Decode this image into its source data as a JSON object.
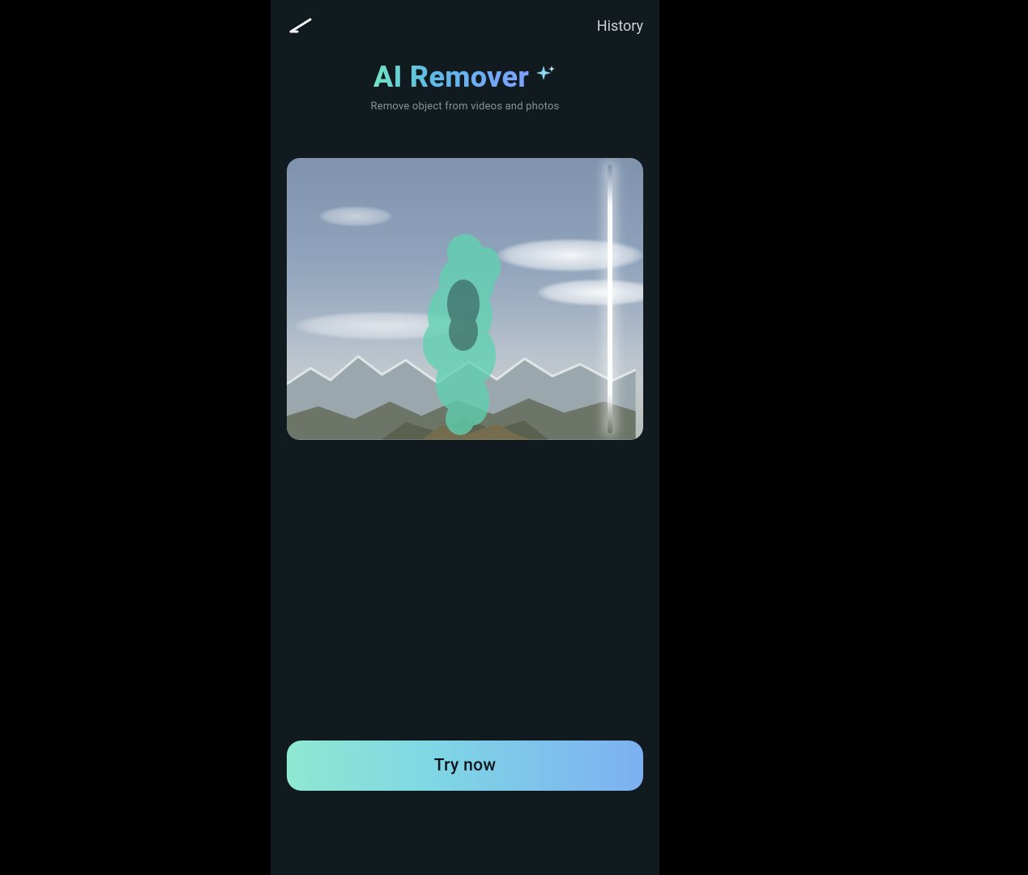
{
  "header": {
    "history_label": "History"
  },
  "hero": {
    "title": "AI Remover",
    "subtitle": "Remove object from videos and photos"
  },
  "cta": {
    "label": "Try now"
  },
  "colors": {
    "accent_start": "#8fe8d1",
    "accent_end": "#7db0f2",
    "selection_mask": "#5fd2b0"
  }
}
